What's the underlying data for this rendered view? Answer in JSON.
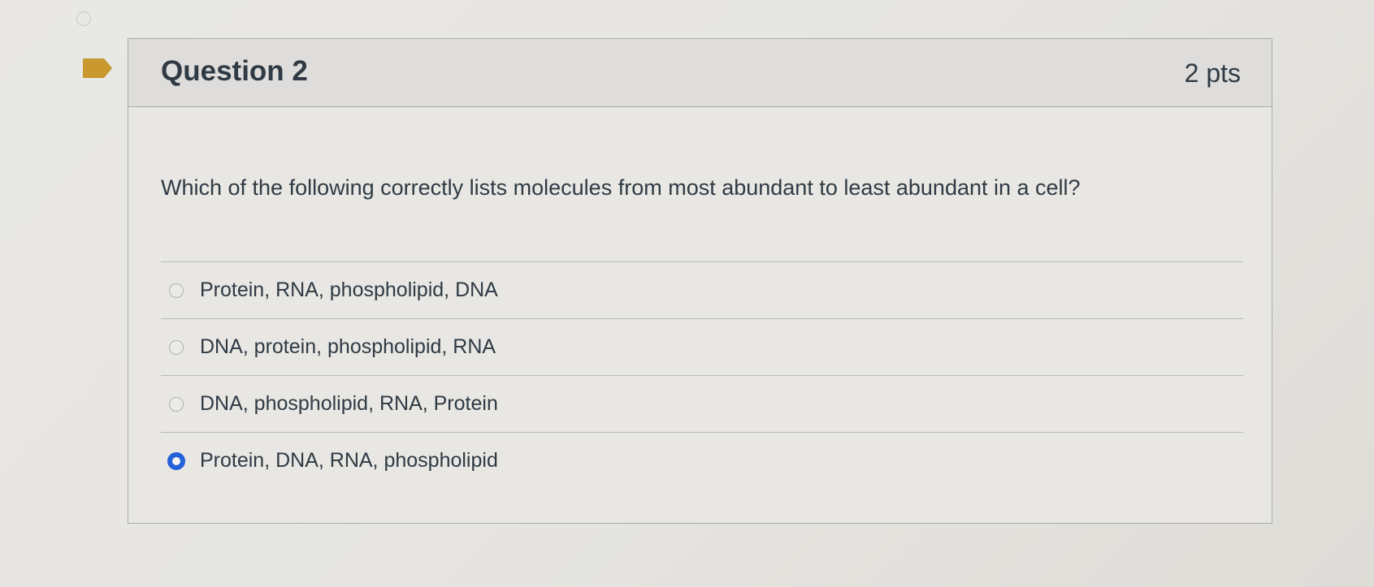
{
  "question": {
    "title": "Question 2",
    "points": "2 pts",
    "text": "Which of the following correctly lists molecules from most abundant to least abundant in a cell?",
    "flag_icon": "flag-icon",
    "flag_color": "#c9982e",
    "selected_index": 3,
    "answers": [
      {
        "label": "Protein, RNA, phospholipid, DNA",
        "selected": false
      },
      {
        "label": "DNA, protein, phospholipid, RNA",
        "selected": false
      },
      {
        "label": "DNA, phospholipid, RNA, Protein",
        "selected": false
      },
      {
        "label": "Protein, DNA, RNA, phospholipid",
        "selected": true
      }
    ]
  },
  "colors": {
    "radio_selected": "#2460d9",
    "text": "#2f3a44",
    "header_bg": "#dedddb",
    "border": "#a9aaa8"
  }
}
